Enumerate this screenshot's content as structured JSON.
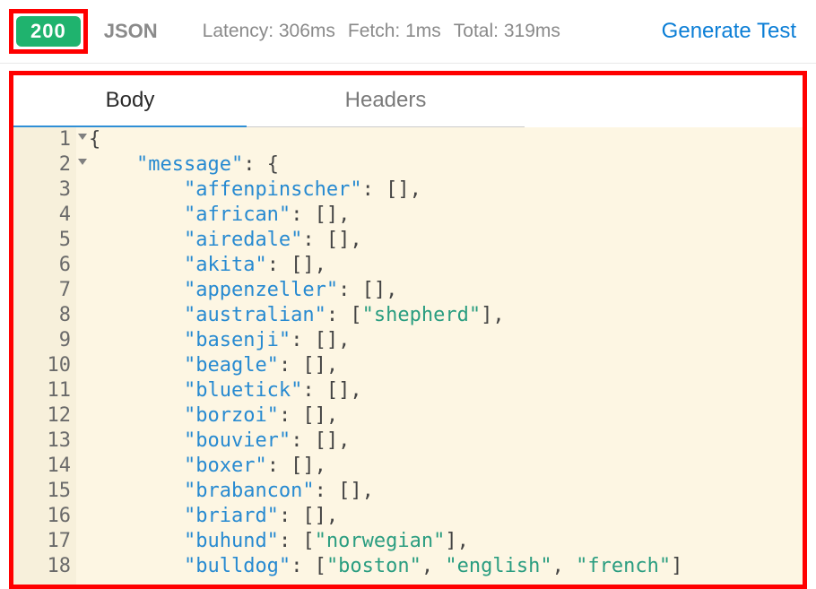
{
  "header": {
    "status_code": "200",
    "format": "JSON",
    "latency_label": "Latency:",
    "latency_value": "306ms",
    "fetch_label": "Fetch:",
    "fetch_value": "1ms",
    "total_label": "Total:",
    "total_value": "319ms",
    "generate_label": "Generate Test"
  },
  "tabs": {
    "body": "Body",
    "headers": "Headers"
  },
  "colors": {
    "status_bg": "#1fb36e",
    "highlight_border": "#ff0000",
    "tab_active_underline": "#2f8fd6",
    "link": "#0b7ed6",
    "editor_bg": "#fdf6e3",
    "key": "#278ad1",
    "string": "#2a9d80"
  },
  "code": {
    "line_numbers": [
      1,
      2,
      3,
      4,
      5,
      6,
      7,
      8,
      9,
      10,
      11,
      12,
      13,
      14,
      15,
      16,
      17,
      18
    ],
    "fold_lines": [
      1,
      2
    ],
    "lines": [
      {
        "indent": 0,
        "tokens": [
          {
            "t": "pun",
            "v": "{"
          }
        ]
      },
      {
        "indent": 1,
        "tokens": [
          {
            "t": "key",
            "v": "\"message\""
          },
          {
            "t": "pun",
            "v": ": {"
          }
        ]
      },
      {
        "indent": 2,
        "tokens": [
          {
            "t": "key",
            "v": "\"affenpinscher\""
          },
          {
            "t": "pun",
            "v": ": [],"
          }
        ]
      },
      {
        "indent": 2,
        "tokens": [
          {
            "t": "key",
            "v": "\"african\""
          },
          {
            "t": "pun",
            "v": ": [],"
          }
        ]
      },
      {
        "indent": 2,
        "tokens": [
          {
            "t": "key",
            "v": "\"airedale\""
          },
          {
            "t": "pun",
            "v": ": [],"
          }
        ]
      },
      {
        "indent": 2,
        "tokens": [
          {
            "t": "key",
            "v": "\"akita\""
          },
          {
            "t": "pun",
            "v": ": [],"
          }
        ]
      },
      {
        "indent": 2,
        "tokens": [
          {
            "t": "key",
            "v": "\"appenzeller\""
          },
          {
            "t": "pun",
            "v": ": [],"
          }
        ]
      },
      {
        "indent": 2,
        "tokens": [
          {
            "t": "key",
            "v": "\"australian\""
          },
          {
            "t": "pun",
            "v": ": ["
          },
          {
            "t": "str",
            "v": "\"shepherd\""
          },
          {
            "t": "pun",
            "v": "],"
          }
        ]
      },
      {
        "indent": 2,
        "tokens": [
          {
            "t": "key",
            "v": "\"basenji\""
          },
          {
            "t": "pun",
            "v": ": [],"
          }
        ]
      },
      {
        "indent": 2,
        "tokens": [
          {
            "t": "key",
            "v": "\"beagle\""
          },
          {
            "t": "pun",
            "v": ": [],"
          }
        ]
      },
      {
        "indent": 2,
        "tokens": [
          {
            "t": "key",
            "v": "\"bluetick\""
          },
          {
            "t": "pun",
            "v": ": [],"
          }
        ]
      },
      {
        "indent": 2,
        "tokens": [
          {
            "t": "key",
            "v": "\"borzoi\""
          },
          {
            "t": "pun",
            "v": ": [],"
          }
        ]
      },
      {
        "indent": 2,
        "tokens": [
          {
            "t": "key",
            "v": "\"bouvier\""
          },
          {
            "t": "pun",
            "v": ": [],"
          }
        ]
      },
      {
        "indent": 2,
        "tokens": [
          {
            "t": "key",
            "v": "\"boxer\""
          },
          {
            "t": "pun",
            "v": ": [],"
          }
        ]
      },
      {
        "indent": 2,
        "tokens": [
          {
            "t": "key",
            "v": "\"brabancon\""
          },
          {
            "t": "pun",
            "v": ": [],"
          }
        ]
      },
      {
        "indent": 2,
        "tokens": [
          {
            "t": "key",
            "v": "\"briard\""
          },
          {
            "t": "pun",
            "v": ": [],"
          }
        ]
      },
      {
        "indent": 2,
        "tokens": [
          {
            "t": "key",
            "v": "\"buhund\""
          },
          {
            "t": "pun",
            "v": ": ["
          },
          {
            "t": "str",
            "v": "\"norwegian\""
          },
          {
            "t": "pun",
            "v": "],"
          }
        ]
      },
      {
        "indent": 2,
        "tokens": [
          {
            "t": "key",
            "v": "\"bulldog\""
          },
          {
            "t": "pun",
            "v": ": ["
          },
          {
            "t": "str",
            "v": "\"boston\""
          },
          {
            "t": "pun",
            "v": ", "
          },
          {
            "t": "str",
            "v": "\"english\""
          },
          {
            "t": "pun",
            "v": ", "
          },
          {
            "t": "str",
            "v": "\"french\""
          },
          {
            "t": "pun",
            "v": "]"
          }
        ]
      }
    ]
  }
}
